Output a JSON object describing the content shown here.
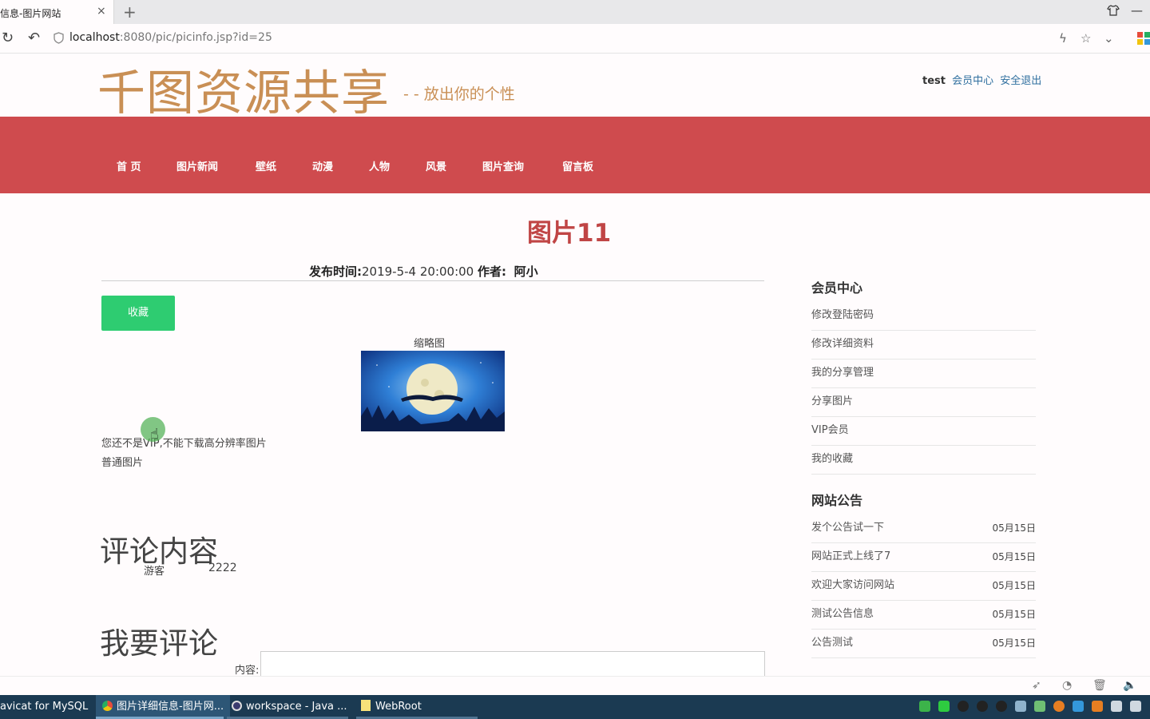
{
  "browser": {
    "tab_title": "信息-图片网站",
    "tab_close": "×",
    "new_tab": "+",
    "url_host": "localhost",
    "url_rest": ":8080/pic/picinfo.jsp?id=25",
    "window_controls": [
      "⇧",
      "—",
      "✕"
    ]
  },
  "site": {
    "logo": "千图资源共享",
    "slogan": "- - 放出你的个性",
    "user": {
      "name": "test",
      "member_center": "会员中心",
      "logout": "安全退出"
    },
    "nav": [
      "首 页",
      "图片新闻",
      "壁纸",
      "动漫",
      "人物",
      "风景",
      "图片查询",
      "留言板"
    ]
  },
  "picture": {
    "title": "图片11",
    "publish_label": "发布时间:",
    "publish_time": "2019-5-4 20:00:00",
    "author_label": "作者:",
    "author": "阿小",
    "favorite_button": "收藏",
    "thumb_label": "缩略图",
    "vip_notice": "您还不是VIP,不能下载高分辨率图片",
    "normal_label": "普通图片"
  },
  "comments": {
    "heading": "评论内容",
    "items": [
      {
        "user": "游客",
        "text": "2222"
      }
    ],
    "write_heading": "我要评论",
    "content_label": "内容:"
  },
  "sidebar": {
    "member_heading": "会员中心",
    "member_items": [
      "修改登陆密码",
      "修改详细资料",
      "我的分享管理",
      "分享图片",
      "VIP会员",
      "我的收藏"
    ],
    "notice_heading": "网站公告",
    "notices": [
      {
        "title": "发个公告试一下",
        "date": "05月15日"
      },
      {
        "title": "网站正式上线了7",
        "date": "05月15日"
      },
      {
        "title": "欢迎大家访问网站",
        "date": "05月15日"
      },
      {
        "title": "测试公告信息",
        "date": "05月15日"
      },
      {
        "title": "公告测试",
        "date": "05月15日"
      }
    ]
  },
  "taskbar": {
    "items": [
      "avicat for MySQL",
      "图片详细信息-图片网...",
      "workspace - Java ...",
      "WebRoot"
    ]
  },
  "colors": {
    "nav_bg": "#cf4b4e",
    "logo": "#c98f55",
    "title": "#c04545",
    "button": "#2ecc71",
    "taskbar": "#1b3a52"
  }
}
